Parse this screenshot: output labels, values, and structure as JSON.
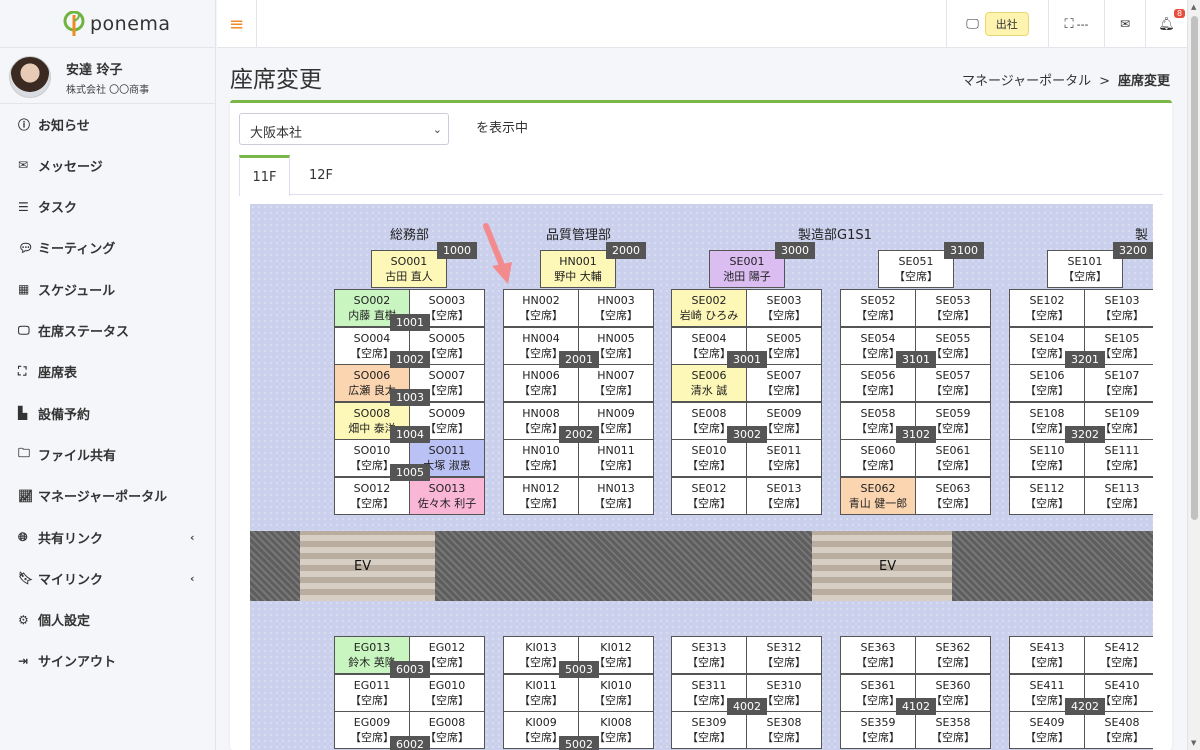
{
  "app": {
    "name": "ponema"
  },
  "user": {
    "name": "安達 玲子",
    "company": "株式会社 〇〇商事"
  },
  "nav": [
    {
      "label": "お知らせ",
      "icon": "info-icon"
    },
    {
      "label": "メッセージ",
      "icon": "mail-icon"
    },
    {
      "label": "タスク",
      "icon": "task-list-icon"
    },
    {
      "label": "ミーティング",
      "icon": "chat-icon"
    },
    {
      "label": "スケジュール",
      "icon": "calendar-icon"
    },
    {
      "label": "在席ステータス",
      "icon": "presence-icon"
    },
    {
      "label": "座席表",
      "icon": "seat-icon"
    },
    {
      "label": "設備予約",
      "icon": "equipment-icon"
    },
    {
      "label": "ファイル共有",
      "icon": "folder-icon"
    },
    {
      "label": "マネージャーポータル",
      "icon": "chart-icon"
    },
    {
      "label": "共有リンク",
      "icon": "globe-icon"
    },
    {
      "label": "マイリンク",
      "icon": "bookmark-icon"
    },
    {
      "label": "個人設定",
      "icon": "gear-icon"
    },
    {
      "label": "サインアウト",
      "icon": "sign-out-icon"
    }
  ],
  "topbar": {
    "checkin_label": "出社",
    "seat_status": "---",
    "notification_count": "8"
  },
  "page": {
    "title": "座席変更",
    "breadcrumb_parent": "マネージャーポータル",
    "breadcrumb_sep": ">",
    "breadcrumb_current": "座席変更"
  },
  "filter": {
    "office": "大阪本社",
    "showing_label": "を表示中"
  },
  "tabs": [
    {
      "label": "11F",
      "active": true
    },
    {
      "label": "12F",
      "active": false
    }
  ],
  "departments": [
    "総務部",
    "品質管理部",
    "製造部G1S1",
    "製造"
  ],
  "top_seats": [
    {
      "code": "SO001",
      "name": "古田 直人",
      "color": "yellow"
    },
    {
      "code": "HN001",
      "name": "野中 大輔",
      "color": "yellow"
    },
    {
      "code": "SE001",
      "name": "池田 陽子",
      "color": "purple"
    },
    {
      "code": "SE051",
      "name": "【空席】",
      "color": "white"
    },
    {
      "code": "SE101",
      "name": "【空席】",
      "color": "white"
    }
  ],
  "top_numbers": [
    "1000",
    "2000",
    "3000",
    "3100",
    "3200"
  ],
  "blocks_upper": [
    {
      "rows": [
        [
          {
            "code": "SO002",
            "name": "内藤 直樹",
            "color": "green"
          },
          {
            "code": "SO003",
            "name": "【空席】",
            "color": "white"
          }
        ],
        [
          {
            "code": "SO004",
            "name": "【空席】",
            "color": "white"
          },
          {
            "code": "SO005",
            "name": "【空席】",
            "color": "white"
          }
        ],
        [
          {
            "code": "SO006",
            "name": "広瀬 良太",
            "color": "orange"
          },
          {
            "code": "SO007",
            "name": "【空席】",
            "color": "white"
          }
        ],
        [
          {
            "code": "SO008",
            "name": "畑中 泰洋",
            "color": "yellow"
          },
          {
            "code": "SO009",
            "name": "【空席】",
            "color": "white"
          }
        ],
        [
          {
            "code": "SO010",
            "name": "【空席】",
            "color": "white"
          },
          {
            "code": "SO011",
            "name": "大塚 淑恵",
            "color": "blue"
          }
        ],
        [
          {
            "code": "SO012",
            "name": "【空席】",
            "color": "white"
          },
          {
            "code": "SO013",
            "name": "佐々木 利子",
            "color": "pink"
          }
        ]
      ],
      "numbers": [
        "1001",
        "1002",
        "1003",
        "1004",
        "1005"
      ]
    },
    {
      "rows": [
        [
          {
            "code": "HN002",
            "name": "【空席】",
            "color": "white"
          },
          {
            "code": "HN003",
            "name": "【空席】",
            "color": "white"
          }
        ],
        [
          {
            "code": "HN004",
            "name": "【空席】",
            "color": "white"
          },
          {
            "code": "HN005",
            "name": "【空席】",
            "color": "white"
          }
        ],
        [
          {
            "code": "HN006",
            "name": "【空席】",
            "color": "white"
          },
          {
            "code": "HN007",
            "name": "【空席】",
            "color": "white"
          }
        ],
        [
          {
            "code": "HN008",
            "name": "【空席】",
            "color": "white"
          },
          {
            "code": "HN009",
            "name": "【空席】",
            "color": "white"
          }
        ],
        [
          {
            "code": "HN010",
            "name": "【空席】",
            "color": "white"
          },
          {
            "code": "HN011",
            "name": "【空席】",
            "color": "white"
          }
        ],
        [
          {
            "code": "HN012",
            "name": "【空席】",
            "color": "white"
          },
          {
            "code": "HN013",
            "name": "【空席】",
            "color": "white"
          }
        ]
      ],
      "numbers": [
        "2001",
        "2002"
      ]
    },
    {
      "rows": [
        [
          {
            "code": "SE002",
            "name": "岩崎 ひろみ",
            "color": "yellow"
          },
          {
            "code": "SE003",
            "name": "【空席】",
            "color": "white"
          }
        ],
        [
          {
            "code": "SE004",
            "name": "【空席】",
            "color": "white"
          },
          {
            "code": "SE005",
            "name": "【空席】",
            "color": "white"
          }
        ],
        [
          {
            "code": "SE006",
            "name": "清水 誠",
            "color": "yellow"
          },
          {
            "code": "SE007",
            "name": "【空席】",
            "color": "white"
          }
        ],
        [
          {
            "code": "SE008",
            "name": "【空席】",
            "color": "white"
          },
          {
            "code": "SE009",
            "name": "【空席】",
            "color": "white"
          }
        ],
        [
          {
            "code": "SE010",
            "name": "【空席】",
            "color": "white"
          },
          {
            "code": "SE011",
            "name": "【空席】",
            "color": "white"
          }
        ],
        [
          {
            "code": "SE012",
            "name": "【空席】",
            "color": "white"
          },
          {
            "code": "SE013",
            "name": "【空席】",
            "color": "white"
          }
        ]
      ],
      "numbers": [
        "3001",
        "3002"
      ]
    },
    {
      "rows": [
        [
          {
            "code": "SE052",
            "name": "【空席】",
            "color": "white"
          },
          {
            "code": "SE053",
            "name": "【空席】",
            "color": "white"
          }
        ],
        [
          {
            "code": "SE054",
            "name": "【空席】",
            "color": "white"
          },
          {
            "code": "SE055",
            "name": "【空席】",
            "color": "white"
          }
        ],
        [
          {
            "code": "SE056",
            "name": "【空席】",
            "color": "white"
          },
          {
            "code": "SE057",
            "name": "【空席】",
            "color": "white"
          }
        ],
        [
          {
            "code": "SE058",
            "name": "【空席】",
            "color": "white"
          },
          {
            "code": "SE059",
            "name": "【空席】",
            "color": "white"
          }
        ],
        [
          {
            "code": "SE060",
            "name": "【空席】",
            "color": "white"
          },
          {
            "code": "SE061",
            "name": "【空席】",
            "color": "white"
          }
        ],
        [
          {
            "code": "SE062",
            "name": "青山 健一郎",
            "color": "orange"
          },
          {
            "code": "SE063",
            "name": "【空席】",
            "color": "white"
          }
        ]
      ],
      "numbers": [
        "3101",
        "3102"
      ]
    },
    {
      "rows": [
        [
          {
            "code": "SE102",
            "name": "【空席】",
            "color": "white"
          },
          {
            "code": "SE103",
            "name": "【空席】",
            "color": "white"
          }
        ],
        [
          {
            "code": "SE104",
            "name": "【空席】",
            "color": "white"
          },
          {
            "code": "SE105",
            "name": "【空席】",
            "color": "white"
          }
        ],
        [
          {
            "code": "SE106",
            "name": "【空席】",
            "color": "white"
          },
          {
            "code": "SE107",
            "name": "【空席】",
            "color": "white"
          }
        ],
        [
          {
            "code": "SE108",
            "name": "【空席】",
            "color": "white"
          },
          {
            "code": "SE109",
            "name": "【空席】",
            "color": "white"
          }
        ],
        [
          {
            "code": "SE110",
            "name": "【空席】",
            "color": "white"
          },
          {
            "code": "SE111",
            "name": "【空席】",
            "color": "white"
          }
        ],
        [
          {
            "code": "SE112",
            "name": "【空席】",
            "color": "white"
          },
          {
            "code": "SE113",
            "name": "【空席】",
            "color": "white"
          }
        ]
      ],
      "numbers": [
        "3201",
        "3202"
      ]
    }
  ],
  "ev_label": "EV",
  "blocks_lower": [
    {
      "rows": [
        [
          {
            "code": "EG013",
            "name": "鈴木 英隆",
            "color": "green"
          },
          {
            "code": "EG012",
            "name": "【空席】",
            "color": "white"
          }
        ],
        [
          {
            "code": "EG011",
            "name": "【空席】",
            "color": "white"
          },
          {
            "code": "EG010",
            "name": "【空席】",
            "color": "white"
          }
        ],
        [
          {
            "code": "EG009",
            "name": "【空席】",
            "color": "white"
          },
          {
            "code": "EG008",
            "name": "【空席】",
            "color": "white"
          }
        ]
      ],
      "numbers": [
        "6003",
        "6002"
      ]
    },
    {
      "rows": [
        [
          {
            "code": "KI013",
            "name": "【空席】",
            "color": "white"
          },
          {
            "code": "KI012",
            "name": "【空席】",
            "color": "white"
          }
        ],
        [
          {
            "code": "KI011",
            "name": "【空席】",
            "color": "white"
          },
          {
            "code": "KI010",
            "name": "【空席】",
            "color": "white"
          }
        ],
        [
          {
            "code": "KI009",
            "name": "【空席】",
            "color": "white"
          },
          {
            "code": "KI008",
            "name": "【空席】",
            "color": "white"
          }
        ]
      ],
      "numbers": [
        "5003",
        "5002"
      ]
    },
    {
      "rows": [
        [
          {
            "code": "SE313",
            "name": "【空席】",
            "color": "white"
          },
          {
            "code": "SE312",
            "name": "【空席】",
            "color": "white"
          }
        ],
        [
          {
            "code": "SE311",
            "name": "【空席】",
            "color": "white"
          },
          {
            "code": "SE310",
            "name": "【空席】",
            "color": "white"
          }
        ],
        [
          {
            "code": "SE309",
            "name": "【空席】",
            "color": "white"
          },
          {
            "code": "SE308",
            "name": "【空席】",
            "color": "white"
          }
        ]
      ],
      "numbers": [
        "4002"
      ]
    },
    {
      "rows": [
        [
          {
            "code": "SE363",
            "name": "【空席】",
            "color": "white"
          },
          {
            "code": "SE362",
            "name": "【空席】",
            "color": "white"
          }
        ],
        [
          {
            "code": "SE361",
            "name": "【空席】",
            "color": "white"
          },
          {
            "code": "SE360",
            "name": "【空席】",
            "color": "white"
          }
        ],
        [
          {
            "code": "SE359",
            "name": "【空席】",
            "color": "white"
          },
          {
            "code": "SE358",
            "name": "【空席】",
            "color": "white"
          }
        ]
      ],
      "numbers": [
        "4102"
      ]
    },
    {
      "rows": [
        [
          {
            "code": "SE413",
            "name": "【空席】",
            "color": "white"
          },
          {
            "code": "SE412",
            "name": "【空席】",
            "color": "white"
          }
        ],
        [
          {
            "code": "SE411",
            "name": "【空席】",
            "color": "white"
          },
          {
            "code": "SE410",
            "name": "【空席】",
            "color": "white"
          }
        ],
        [
          {
            "code": "SE409",
            "name": "【空席】",
            "color": "white"
          },
          {
            "code": "SE408",
            "name": "【空席】",
            "color": "white"
          }
        ]
      ],
      "numbers": [
        "4202"
      ]
    }
  ],
  "highlighted_seat": "HN002",
  "colors": {
    "accent": "#7ab648",
    "menu_icon": "#f08a24",
    "highlight": "#f38b8e",
    "floor_bg": "#cbd0ec"
  }
}
